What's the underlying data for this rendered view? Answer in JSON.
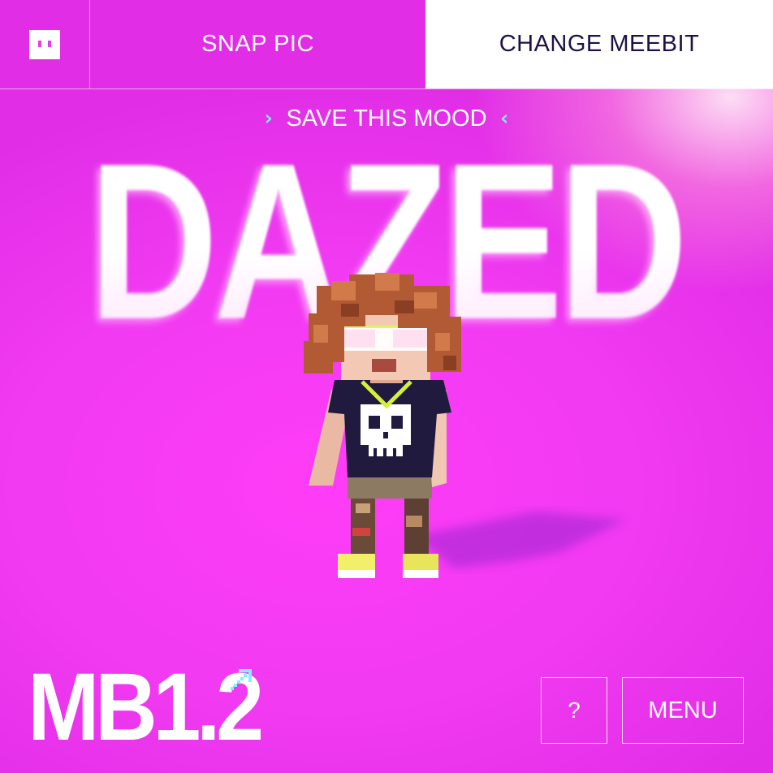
{
  "topbar": {
    "logo_icon": "meebit-face-icon",
    "snap_label": "SNAP PIC",
    "change_label": "CHANGE MEEBIT"
  },
  "mood": {
    "save_label": "SAVE THIS MOOD",
    "left_arrow": "›",
    "right_arrow": "‹",
    "word": "DAZED"
  },
  "footer": {
    "version": "MB1.2",
    "version_icon": "pixel-arrow-up-right-icon",
    "help_label": "?",
    "menu_label": "MENU"
  },
  "colors": {
    "accent_cyan": "#7ef0ff",
    "background_magenta": "#ee36f0",
    "navy_text": "#1a1446"
  }
}
